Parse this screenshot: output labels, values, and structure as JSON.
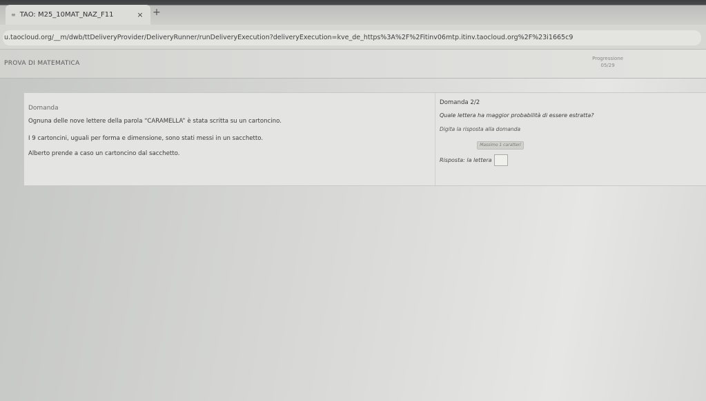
{
  "browser": {
    "tab": {
      "favicon": "≡",
      "title": "TAO: M25_10MAT_NAZ_F11",
      "close": "×"
    },
    "new_tab": "+",
    "url": "u.taocloud.org/__m/dwb/ttDeliveryProvider/DeliveryRunner/runDeliveryExecution?deliveryExecution=kve_de_https%3A%2F%2Fitinv06mtp.itinv.taocloud.org%2F%23i1665c9"
  },
  "header": {
    "test_title": "PROVA DI MATEMATICA",
    "progress_label": "Progressione",
    "progress_value": "05/29"
  },
  "stimulus": {
    "heading": "Domanda",
    "line1": "Ognuna delle nove lettere della parola “CARAMELLA” è stata scritta su un cartoncino.",
    "line2": "I 9 cartoncini, uguali per forma e dimensione, sono stati messi in un sacchetto.",
    "line3": "Alberto prende a caso un cartoncino dal sacchetto."
  },
  "question": {
    "number": "Domanda 2/2",
    "prompt": "Quale lettera ha maggior probabilità di essere estratta?",
    "instruction": "Digita la risposta alla domanda",
    "char_counter": "Massimo 1 caratteri",
    "answer_label": "Risposta: la lettera",
    "answer_value": ""
  }
}
